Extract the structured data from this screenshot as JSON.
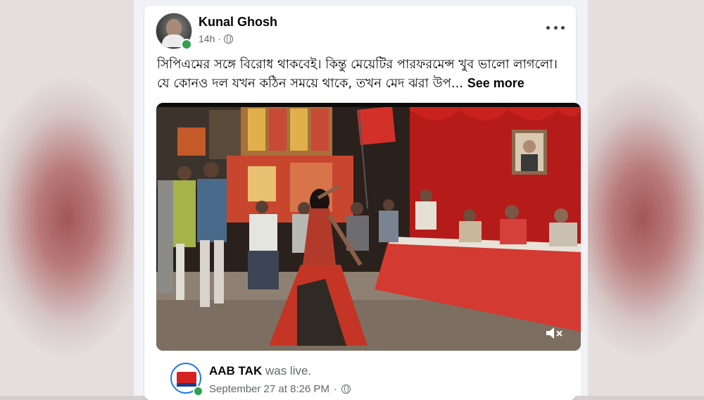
{
  "post": {
    "author": "Kunal Ghosh",
    "time": "14h",
    "separator": "·",
    "text": "সিপিএমের সঙ্গে বিরোধ থাকবেই। কিন্তু মেয়েটির পারফরমেন্স খুব ভালো লাগলো। যে কোনও দল যখন কঠিন সময়ে থাকে, তখন মেদ ঝরা উপ...",
    "see_more": "See more"
  },
  "shared": {
    "page_name": "AAB TAK",
    "status": "was live.",
    "date": "September 27 at 8:26 PM",
    "separator": "·"
  },
  "icons": {
    "privacy": "globe-icon",
    "options": "more-options-icon",
    "volume": "muted-speaker-icon"
  },
  "colors": {
    "online": "#31a24c",
    "accent": "#1877f2",
    "stage_red": "#d4302a"
  }
}
